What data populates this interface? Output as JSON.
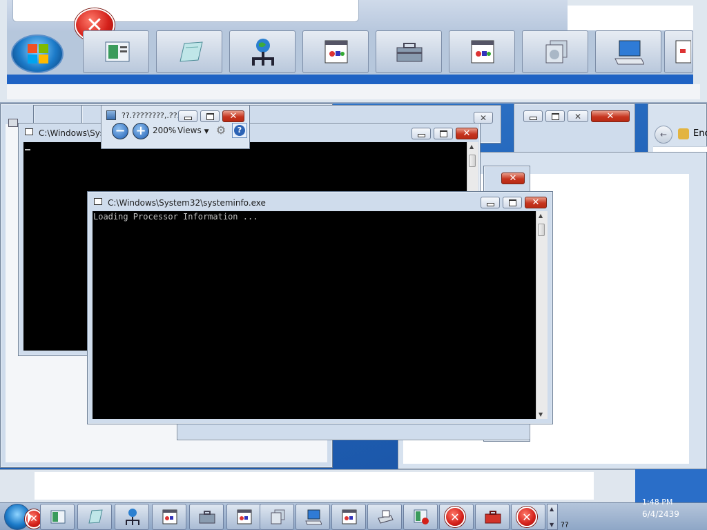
{
  "launcher": {
    "tiles": [
      {
        "icon": "control-panel-icon"
      },
      {
        "icon": "notepad-icon"
      },
      {
        "icon": "network-globe-icon"
      },
      {
        "icon": "application-window-icon"
      },
      {
        "icon": "toolbox-icon"
      },
      {
        "icon": "application-window-icon"
      },
      {
        "icon": "image-gallery-icon"
      },
      {
        "icon": "keyboard-monitor-icon"
      },
      {
        "icon": "document-icon"
      }
    ]
  },
  "mag_toolbar": {
    "title": "??.????????,.??...",
    "zoom_level": "200%",
    "views_label": "Views"
  },
  "back_console": {
    "title": "C:\\Windows\\Syst"
  },
  "front_console": {
    "title": "C:\\Windows\\System32\\systeminfo.exe",
    "output": "Loading Processor Information ..."
  },
  "right_window": {
    "address_text": "Enc"
  },
  "taskbar": {
    "buttons": [
      {
        "icon": "control-panel-icon"
      },
      {
        "icon": "notepad-icon"
      },
      {
        "icon": "network-globe-icon"
      },
      {
        "icon": "application-window-icon"
      },
      {
        "icon": "toolbox-icon"
      },
      {
        "icon": "application-window-icon"
      },
      {
        "icon": "image-gallery-icon"
      },
      {
        "icon": "keyboard-monitor-icon"
      },
      {
        "icon": "application-window-icon"
      },
      {
        "icon": "printer-icon"
      },
      {
        "icon": "recording-window-icon"
      },
      {
        "icon": "error-icon"
      },
      {
        "icon": "red-toolbox-icon"
      },
      {
        "icon": "error-icon"
      }
    ],
    "clock_time": "1:48 PM",
    "clock_date": "6/4/2439",
    "tray_text": "??"
  },
  "colors": {
    "desktop": "#2a6ec8",
    "console_bg": "#000000",
    "close_red": "#c6351f"
  }
}
